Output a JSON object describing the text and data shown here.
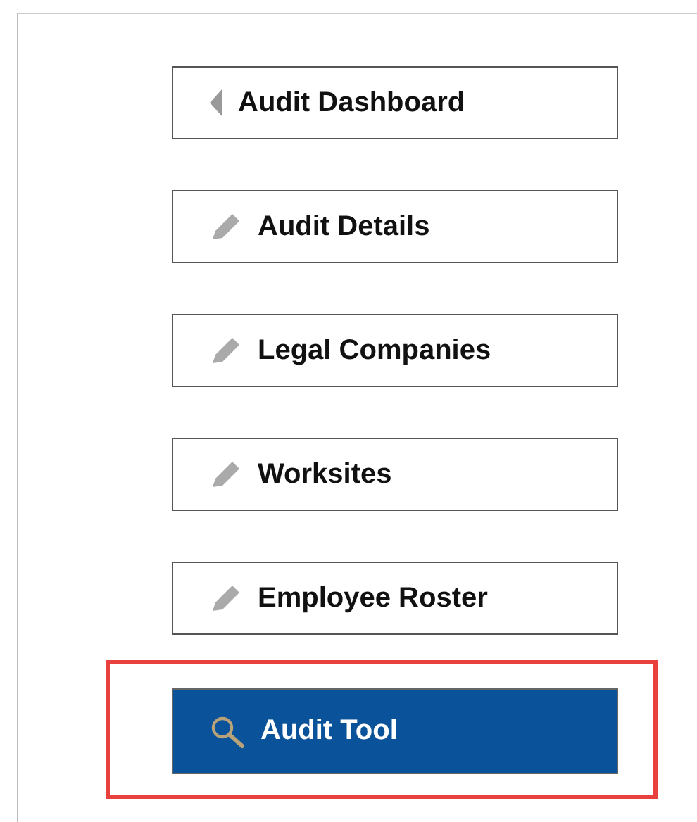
{
  "nav_buttons": [
    {
      "label": "Audit Dashboard",
      "kind": "back",
      "selected": false,
      "highlighted": false
    },
    {
      "label": "Audit Details",
      "kind": "edit",
      "selected": false,
      "highlighted": false
    },
    {
      "label": "Legal Companies",
      "kind": "edit",
      "selected": false,
      "highlighted": false
    },
    {
      "label": "Worksites",
      "kind": "edit",
      "selected": false,
      "highlighted": false
    },
    {
      "label": "Employee Roster",
      "kind": "edit",
      "selected": false,
      "highlighted": false
    },
    {
      "label": "Audit Tool",
      "kind": "search",
      "selected": true,
      "highlighted": true
    }
  ]
}
